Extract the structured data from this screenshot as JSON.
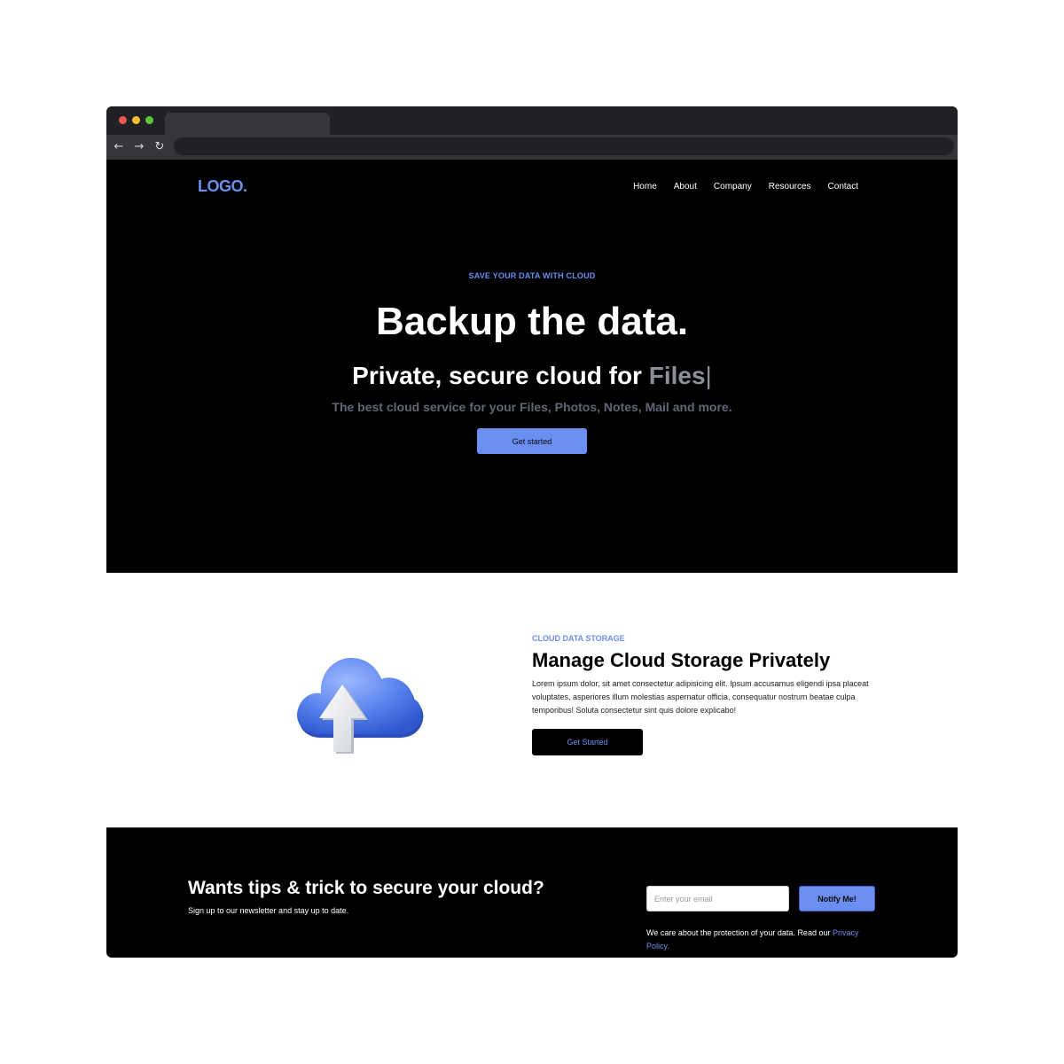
{
  "browser": {
    "controls": [
      "close",
      "minimize",
      "maximize"
    ],
    "nav_icons": [
      "back-arrow-icon",
      "forward-arrow-icon",
      "reload-icon"
    ]
  },
  "nav": {
    "logo": "LOGO.",
    "links": [
      "Home",
      "About",
      "Company",
      "Resources",
      "Contact"
    ]
  },
  "hero": {
    "eyebrow": "SAVE YOUR DATA WITH CLOUD",
    "title": "Backup the data.",
    "subtitle_prefix": "Private, secure cloud for ",
    "subtitle_typed": "Files",
    "caret": "|",
    "description": "The best cloud service for your Files, Photos, Notes, Mail and more.",
    "cta": "Get started"
  },
  "feature": {
    "eyebrow": "CLOUD DATA STORAGE",
    "title": "Manage Cloud Storage Privately",
    "text": "Lorem ipsum dolor, sit amet consectetur adipisicing elit. Ipsum accusamus eligendi ipsa placeat voluptates, asperiores illum molestias aspernatur officia, consequatur nostrum beatae culpa temporibus! Soluta consectetur sint quis dolore explicabo!",
    "cta": "Get Started",
    "image_icon": "cloud-upload-icon"
  },
  "newsletter": {
    "title": "Wants tips & trick to secure your cloud?",
    "subtitle": "Sign up to our newsletter and stay up to date.",
    "email_placeholder": "Enter your email",
    "email_value": "",
    "button": "Notify Me!",
    "privacy_text": "We care about the protection of your data. Read our ",
    "privacy_link": "Privacy Policy."
  },
  "colors": {
    "accent": "#6a8ff0",
    "background_dark": "#000000",
    "chrome": "#202124"
  }
}
